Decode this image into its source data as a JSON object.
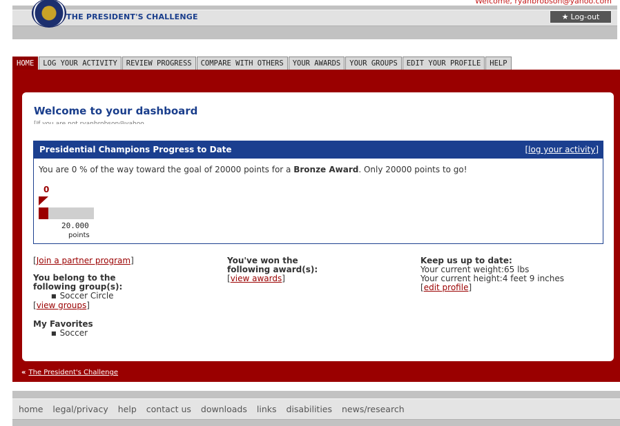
{
  "header": {
    "site_title": "THE PRESIDENT'S CHALLENGE",
    "welcome_user": "Welcome, ryanbrobson@yahoo.com",
    "logout_label": "Log-out",
    "logo_icon": "presidential-seal-icon"
  },
  "nav": {
    "tabs": [
      {
        "label": "HOME",
        "active": true
      },
      {
        "label": "LOG YOUR ACTIVITY",
        "active": false
      },
      {
        "label": "REVIEW PROGRESS",
        "active": false
      },
      {
        "label": "COMPARE WITH OTHERS",
        "active": false
      },
      {
        "label": "YOUR AWARDS",
        "active": false
      },
      {
        "label": "YOUR GROUPS",
        "active": false
      },
      {
        "label": "EDIT YOUR PROFILE",
        "active": false
      },
      {
        "label": "HELP",
        "active": false
      }
    ]
  },
  "dashboard": {
    "title": "Welcome to your dashboard",
    "subtitle": "[If you are not ryanbrobson@yahoo"
  },
  "progress": {
    "title": "Presidential Champions Progress to Date",
    "link": "log your activity",
    "message_pre": "You are 0 % of the way toward the goal of 20000 points for a ",
    "message_award": "Bronze Award",
    "message_post": ". Only 20000 points to go!",
    "current_points": "0",
    "goal_points": "20.000",
    "goal_unit": "points",
    "percent_complete": 0
  },
  "left_column": {
    "partner_link": "Join a partner program",
    "groups_heading_1": "You belong to the",
    "groups_heading_2": "following group(s):",
    "groups": [
      "Soccer Circle"
    ],
    "view_groups_link": "view groups",
    "favorites_heading": "My Favorites",
    "favorites": [
      "Soccer"
    ]
  },
  "middle_column": {
    "awards_heading_1": "You've won the",
    "awards_heading_2": "following award(s):",
    "view_awards_link": "view awards"
  },
  "right_column": {
    "heading": "Keep us up to date:",
    "weight": "Your current weight:65 lbs",
    "height": "Your current height:4 feet 9 inches",
    "edit_profile_link": "edit profile"
  },
  "back_link": {
    "label": "The President's Challenge"
  },
  "footer": {
    "links": [
      "home",
      "legal/privacy",
      "help",
      "contact us",
      "downloads",
      "links",
      "disabilities",
      "news/research"
    ]
  },
  "colors": {
    "brand_red": "#9a0000",
    "brand_blue": "#1b3f8f"
  }
}
